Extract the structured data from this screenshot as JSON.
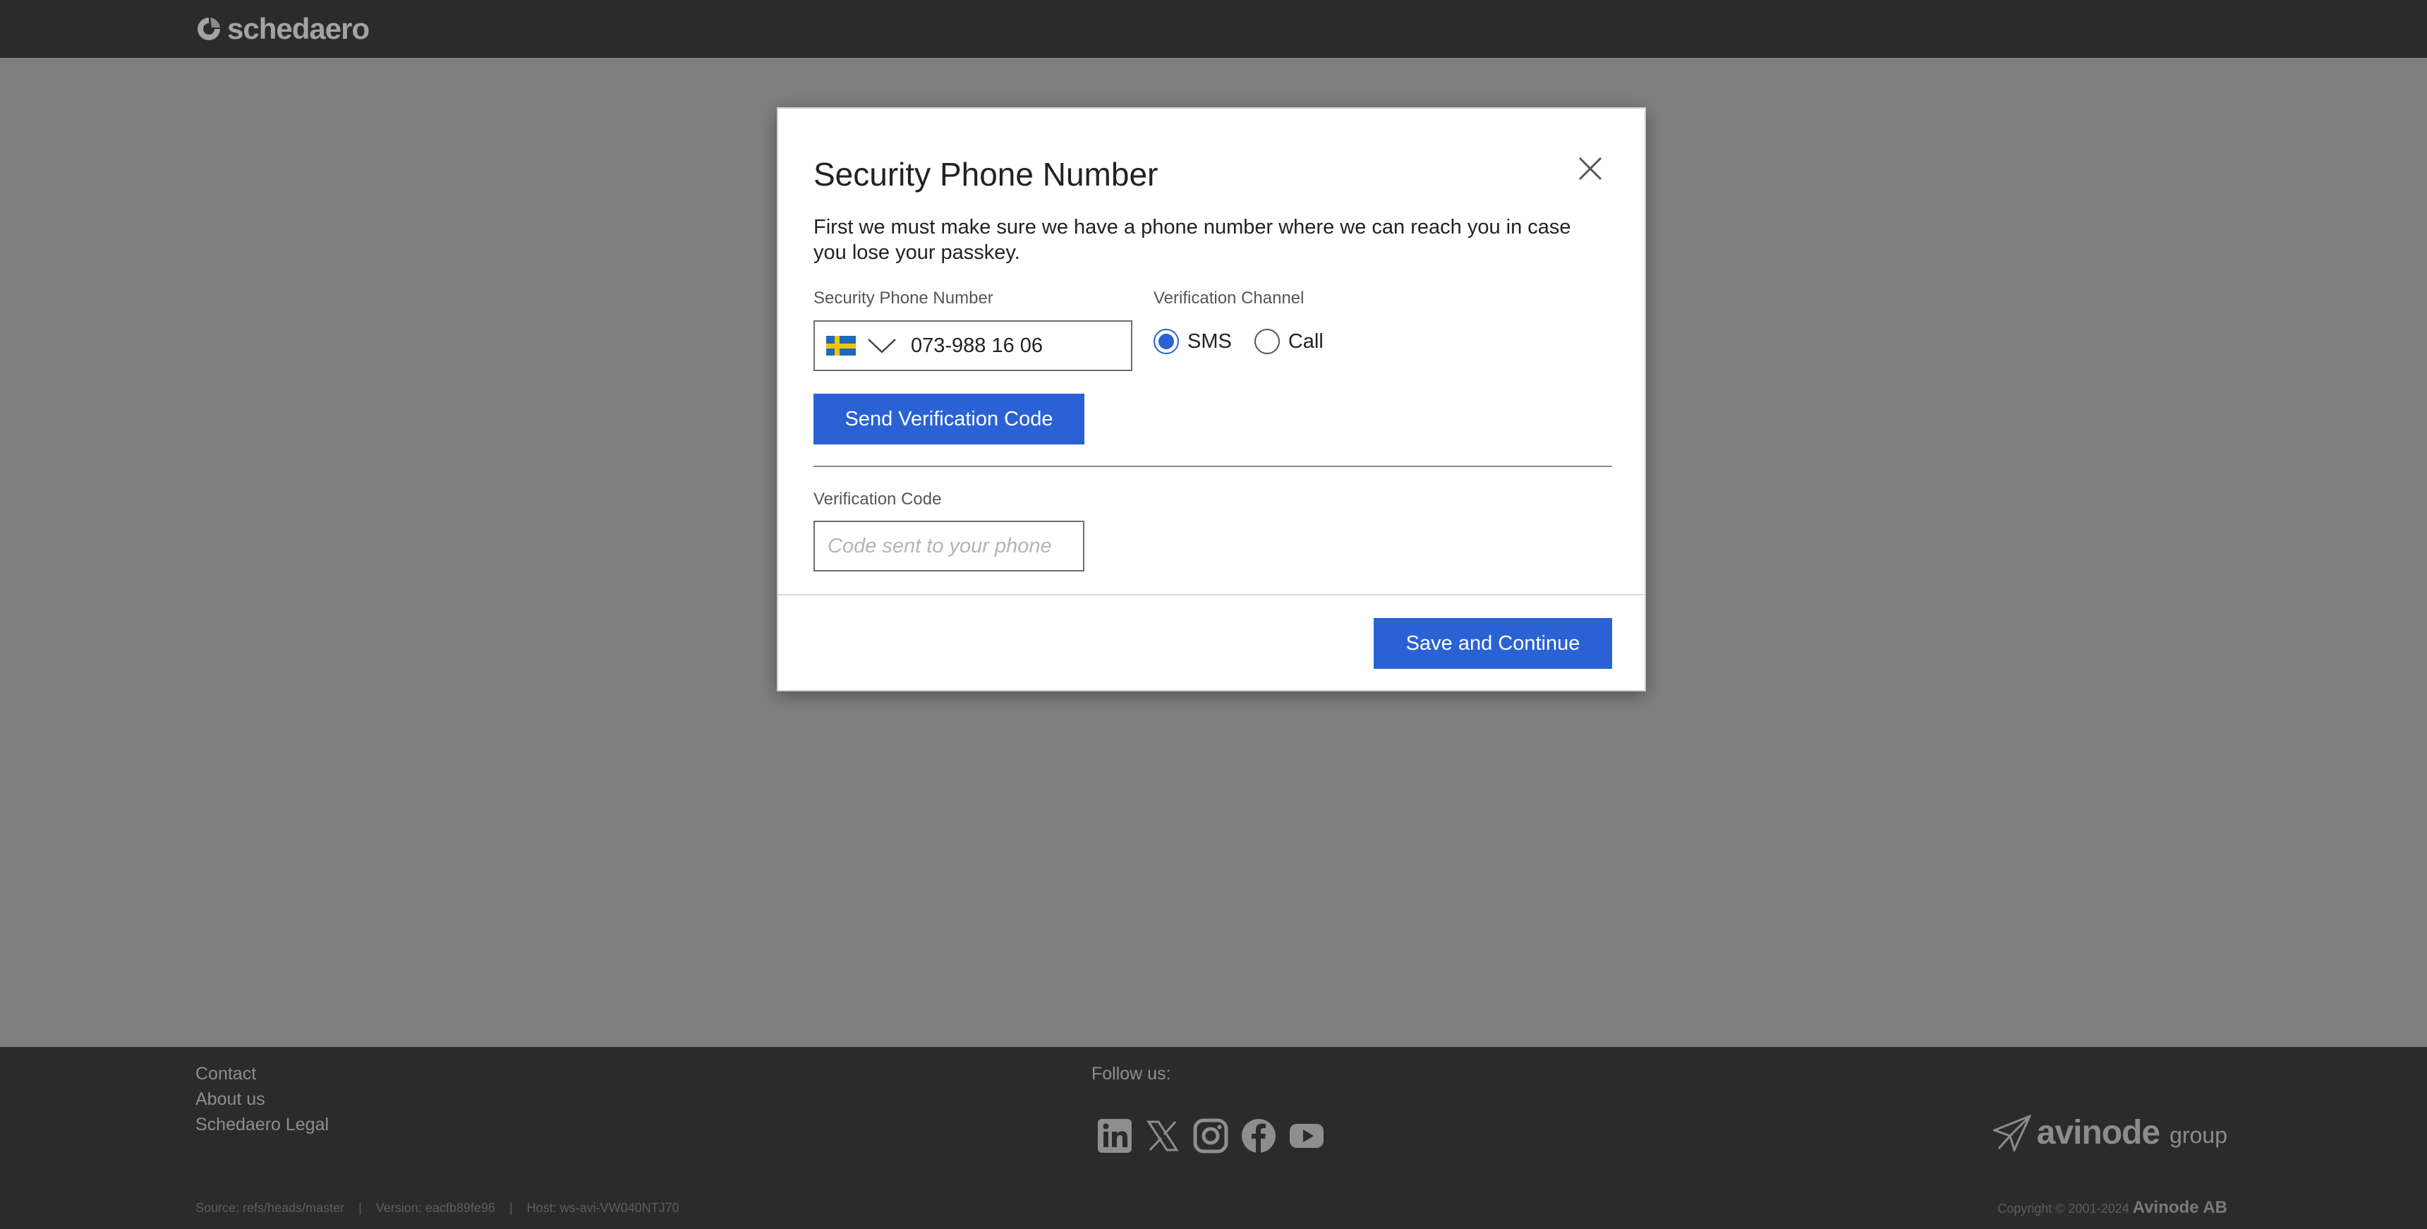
{
  "header": {
    "logo_text": "schedaero"
  },
  "modal": {
    "title": "Security Phone Number",
    "description": "First we must make sure we have a phone number where we can reach you in case you lose your passkey.",
    "phone_label": "Security Phone Number",
    "phone_country_flag": "sweden-flag",
    "phone_value": "073-988 16 06",
    "channel_label": "Verification Channel",
    "channel_options": [
      {
        "label": "SMS",
        "selected": true
      },
      {
        "label": "Call",
        "selected": false
      }
    ],
    "send_button": "Send Verification Code",
    "code_label": "Verification Code",
    "code_placeholder": "Code sent to your phone",
    "code_value": "",
    "save_button": "Save and Continue"
  },
  "footer": {
    "links": [
      "Contact",
      "About us",
      "Schedaero Legal"
    ],
    "follow_label": "Follow us:",
    "social_icons": [
      "linkedin-icon",
      "x-icon",
      "instagram-icon",
      "facebook-icon",
      "youtube-icon"
    ],
    "brand_name": "avinode",
    "brand_suffix": "group",
    "meta_source": "Source: refs/heads/master",
    "meta_version": "Version: eacfb89fe96",
    "meta_host": "Host: ws-avi-VW040NTJ70",
    "copyright_prefix": "Copyright © 2001-2024",
    "copyright_company": "Avinode AB"
  },
  "colors": {
    "accent": "#2a62d6",
    "bar": "#2b2b2b",
    "backdrop": "#7f7f7f"
  }
}
